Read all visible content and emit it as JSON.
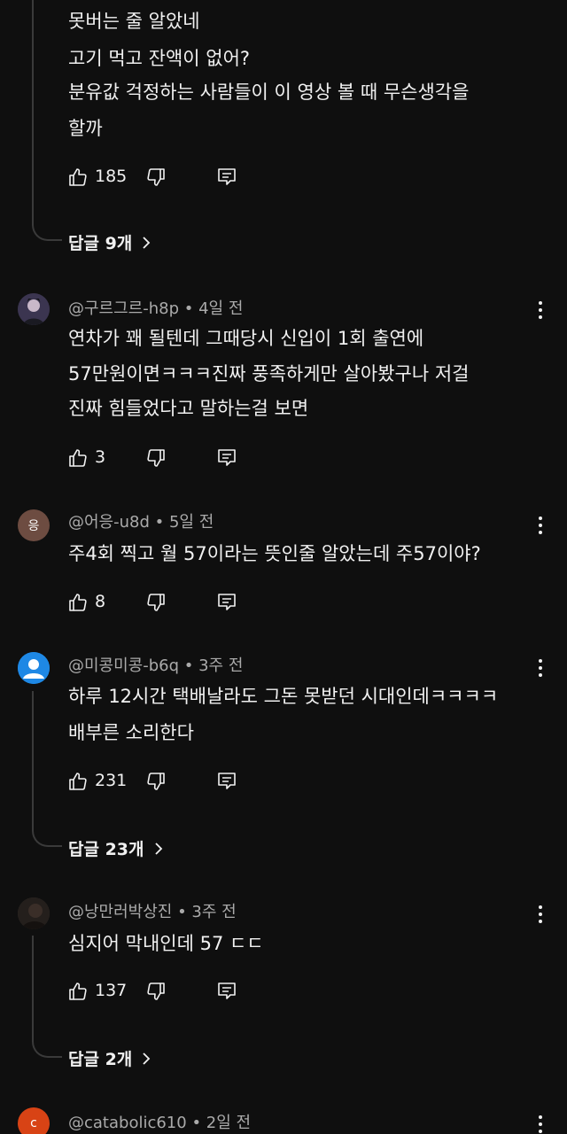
{
  "comments": [
    {
      "author": "",
      "time": "",
      "lines": [
        "못버는 줄 알았네",
        "고기 먹고 잔액이 없어?",
        "분유값 걱정하는 사람들이 이 영상 볼 때 무슨생각을",
        "할까"
      ],
      "likes": "185",
      "replies": "답글 9개"
    },
    {
      "author": "@구르그르-h8p",
      "time": "4일 전",
      "lines": [
        "연차가 꽤 될텐데 그때당시 신입이 1회 출연에",
        "57만원이면ㅋㅋㅋ진짜 풍족하게만 살아봤구나 저걸",
        "진짜 힘들었다고 말하는걸 보면"
      ],
      "likes": "3",
      "avatar_color": "#2a2a3a"
    },
    {
      "author": "@어응-u8d",
      "time": "5일 전",
      "lines": [
        "주4회 찍고 월 57이라는 뜻인줄 알았는데 주57이야?"
      ],
      "likes": "8",
      "avatar_letter": "응",
      "avatar_color": "#6d4c41"
    },
    {
      "author": "@미콩미콩-b6q",
      "time": "3주 전",
      "lines": [
        "하루 12시간 택배날라도 그돈 못받던 시대인데ㅋㅋㅋㅋ",
        "배부른 소리한다"
      ],
      "likes": "231",
      "replies": "답글 23개",
      "avatar_color": "#1e88e5"
    },
    {
      "author": "@낭만러박상진",
      "time": "3주 전",
      "lines": [
        "심지어 막내인데 57 ㄷㄷ"
      ],
      "likes": "137",
      "replies": "답글 2개",
      "avatar_color": "#3b3530"
    },
    {
      "author": "@catabolic610",
      "time": "2일 전",
      "avatar_letter": "c",
      "avatar_color": "#d84315"
    }
  ],
  "icons": {
    "like": "thumbs-up-icon",
    "dislike": "thumbs-down-icon",
    "reply": "reply-icon",
    "more": "more-vert-icon",
    "chevron": "chevron-right-icon"
  }
}
